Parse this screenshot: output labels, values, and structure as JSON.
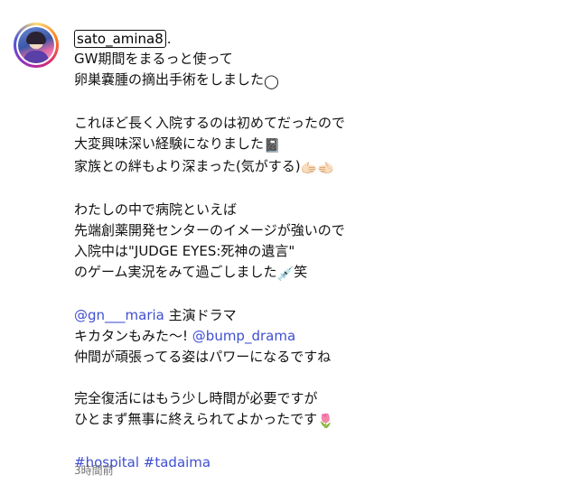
{
  "post": {
    "username": "sato_amina8",
    "username_suffix": ".",
    "lines": {
      "l1": "GW期間をまるっと使って",
      "l2": "卵巣嚢腫の摘出手術をしました",
      "l2_emoji": "◯",
      "l3": "これほど長く入院するのは初めてだったので",
      "l4": "大変興味深い経験になりました",
      "l4_emoji": "📓",
      "l5": "家族との絆もより深まった(気がする)",
      "l5_emoji": "🫱🏻‍🫲🏻",
      "l6": "わたしの中で病院といえば",
      "l7": "先端創薬開発センターのイメージが強いので",
      "l8": "入院中は\"JUDGE EYES:死神の遺言\"",
      "l9_before": "のゲーム実況をみて過ごしました",
      "l9_emoji": "💉",
      "l9_after": "笑",
      "l10_mention": "@gn___maria",
      "l10_text": " 主演ドラマ",
      "l11_text": "キカタンもみた〜! ",
      "l11_mention": "@bump_drama",
      "l12": "仲間が頑張ってる姿はパワーになるですね",
      "l13": "完全復活にはもう少し時間が必要ですが",
      "l14": "ひとまず無事に終えられてよかったです",
      "l14_emoji": "🌷",
      "hashtag1": "#hospital",
      "hashtag2": "#tadaima"
    },
    "timestamp": "3時間前"
  },
  "colors": {
    "link": "#3f4fd1",
    "timestamp": "#737373",
    "text": "#111111"
  },
  "icons": {
    "avatar": "profile-photo"
  }
}
